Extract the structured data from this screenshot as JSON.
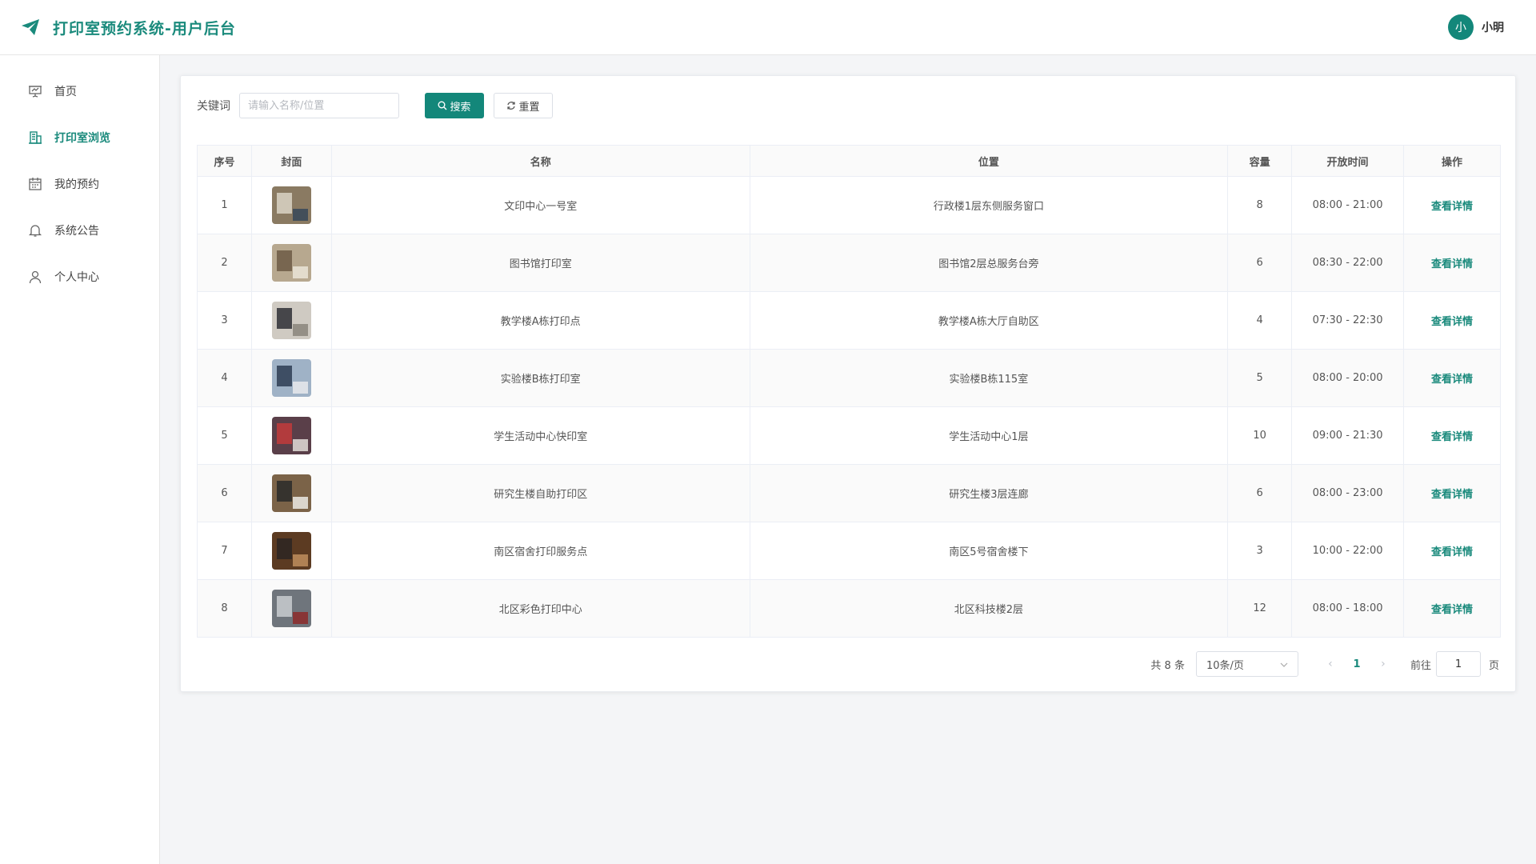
{
  "header": {
    "title": "打印室预约系统-用户后台",
    "avatar_text": "小",
    "user_name": "小明"
  },
  "sidebar": {
    "items": [
      {
        "label": "首页",
        "icon": "presentation-icon",
        "active": false
      },
      {
        "label": "打印室浏览",
        "icon": "building-icon",
        "active": true
      },
      {
        "label": "我的预约",
        "icon": "calendar-icon",
        "active": false
      },
      {
        "label": "系统公告",
        "icon": "bell-icon",
        "active": false
      },
      {
        "label": "个人中心",
        "icon": "user-icon",
        "active": false
      }
    ]
  },
  "search": {
    "label": "关键词",
    "placeholder": "请输入名称/位置",
    "value": "",
    "search_label": "搜索",
    "reset_label": "重置"
  },
  "table": {
    "headers": [
      "序号",
      "封面",
      "名称",
      "位置",
      "容量",
      "开放时间",
      "操作"
    ],
    "rows": [
      {
        "index": "1",
        "name": "文印中心一号室",
        "location": "行政楼1层东侧服务窗口",
        "capacity": "8",
        "hours": "08:00 - 21:00",
        "action": "查看详情",
        "thumb": [
          "#8a7a62",
          "#d9d3c6",
          "#3b4a5a"
        ]
      },
      {
        "index": "2",
        "name": "图书馆打印室",
        "location": "图书馆2层总服务台旁",
        "capacity": "6",
        "hours": "08:30 - 22:00",
        "action": "查看详情",
        "thumb": [
          "#b7a88f",
          "#6d5a45",
          "#e8e1d4"
        ]
      },
      {
        "index": "3",
        "name": "教学楼A栋打印点",
        "location": "教学楼A栋大厅自助区",
        "capacity": "4",
        "hours": "07:30 - 22:30",
        "action": "查看详情",
        "thumb": [
          "#cfcac2",
          "#2e2f35",
          "#8d8880"
        ]
      },
      {
        "index": "4",
        "name": "实验楼B栋打印室",
        "location": "实验楼B栋115室",
        "capacity": "5",
        "hours": "08:00 - 20:00",
        "action": "查看详情",
        "thumb": [
          "#9fb2c6",
          "#2d3c52",
          "#e3e6ea"
        ]
      },
      {
        "index": "5",
        "name": "学生活动中心快印室",
        "location": "学生活动中心1层",
        "capacity": "10",
        "hours": "09:00 - 21:30",
        "action": "查看详情",
        "thumb": [
          "#5a3f49",
          "#c23b3b",
          "#d9d4cf"
        ]
      },
      {
        "index": "6",
        "name": "研究生楼自助打印区",
        "location": "研究生楼3层连廊",
        "capacity": "6",
        "hours": "08:00 - 23:00",
        "action": "查看详情",
        "thumb": [
          "#7b6348",
          "#2a2a2a",
          "#e6e2dc"
        ]
      },
      {
        "index": "7",
        "name": "南区宿舍打印服务点",
        "location": "南区5号宿舍楼下",
        "capacity": "3",
        "hours": "10:00 - 22:00",
        "action": "查看详情",
        "thumb": [
          "#5c3b22",
          "#2c2622",
          "#b9895a"
        ]
      },
      {
        "index": "8",
        "name": "北区彩色打印中心",
        "location": "北区科技楼2层",
        "capacity": "12",
        "hours": "08:00 - 18:00",
        "action": "查看详情",
        "thumb": [
          "#6f757c",
          "#c9ccd0",
          "#8b2f2f"
        ]
      }
    ]
  },
  "pagination": {
    "total_text": "共 8 条",
    "page_size": "10条/页",
    "current_page": "1",
    "goto_label": "前往",
    "goto_value": "1",
    "page_suffix": "页"
  },
  "colors": {
    "accent": "#13877a",
    "accent_text": "#1a8a7c"
  }
}
